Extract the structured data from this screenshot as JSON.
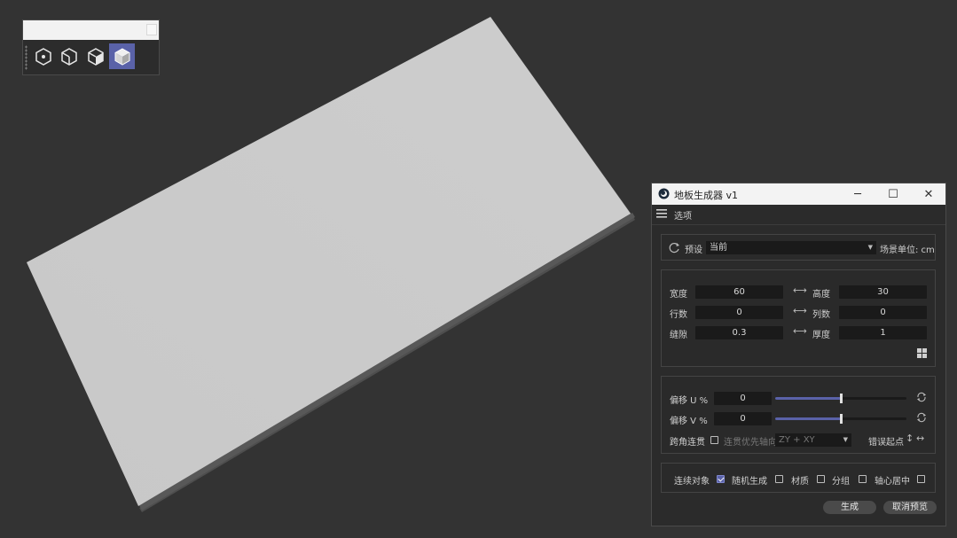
{
  "toolbar": {
    "buttons": [
      {
        "icon": "hexagon-dot-icon",
        "active": false
      },
      {
        "icon": "cube-wire-icon",
        "active": false
      },
      {
        "icon": "cube-half-shaded-icon",
        "active": false
      },
      {
        "icon": "cube-shaded-icon",
        "active": true
      }
    ]
  },
  "window": {
    "title": "地板生成器 v1",
    "menu_label": "选项",
    "controls": {
      "minimize": "─",
      "maximize": "☐",
      "close": "✕"
    }
  },
  "preset": {
    "label": "预设",
    "value": "当前",
    "scene_unit": "场景单位: cm"
  },
  "dimensions": {
    "width_label": "宽度",
    "width_value": "60",
    "height_label": "高度",
    "height_value": "30",
    "rows_label": "行数",
    "rows_value": "0",
    "cols_label": "列数",
    "cols_value": "0",
    "gap_label": "缝隙",
    "gap_value": "0.3",
    "thickness_label": "厚度",
    "thickness_value": "1"
  },
  "offset": {
    "u_label": "偏移 U %",
    "u_value": "0",
    "u_fraction": 0.5,
    "v_label": "偏移 V %",
    "v_value": "0",
    "v_fraction": 0.5,
    "corner_label": "跨角连贯",
    "axis_label": "连贯优先轴向",
    "axis_value": "ZY + XY",
    "start_label": "错误起点"
  },
  "options": {
    "connect_label": "连续对象",
    "random_label": "随机生成",
    "random_checked": true,
    "material_label": "材质",
    "group_label": "分组",
    "center_label": "轴心居中"
  },
  "actions": {
    "generate": "生成",
    "cancel_preview": "取消预览"
  },
  "colors": {
    "accent": "#5a62a8",
    "background": "#333333",
    "slab_top": "#cbcbcb",
    "slab_edge": "#555555"
  }
}
